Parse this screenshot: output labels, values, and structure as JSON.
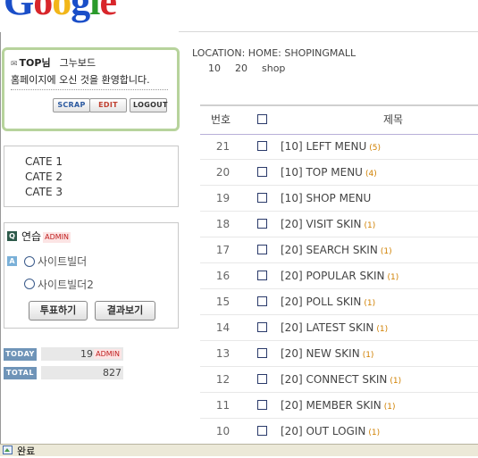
{
  "logo": {
    "text": "Google"
  },
  "login": {
    "user": "TOP님",
    "board_link": "그누보드",
    "welcome": "홈페이지에 오신 것을 환영합니다.",
    "buttons": {
      "scrap": "SCRAP",
      "edit": "EDIT",
      "logout": "LOGOUT"
    }
  },
  "categories": [
    "CATE 1",
    "CATE 2",
    "CATE 3"
  ],
  "poll": {
    "q_icon": "Q",
    "a_icon": "A",
    "title": "연습",
    "admin_badge": "ADMIN",
    "options": [
      "사이트빌더",
      "사이트빌더2"
    ],
    "vote_button": "투표하기",
    "result_button": "결과보기"
  },
  "counter": {
    "today_label": "TODAY",
    "today_value": "19",
    "today_admin": "ADMIN",
    "total_label": "TOTAL",
    "total_value": "827"
  },
  "location": {
    "text": "LOCATION: HOME: SHOPINGMALL",
    "links": [
      "10",
      "20",
      "shop"
    ]
  },
  "table": {
    "col_num": "번호",
    "col_title": "제목",
    "rows": [
      {
        "num": "21",
        "title": "[10] LEFT MENU",
        "comments": "(5)"
      },
      {
        "num": "20",
        "title": "[10] TOP MENU",
        "comments": "(4)"
      },
      {
        "num": "19",
        "title": "[10] SHOP MENU",
        "comments": ""
      },
      {
        "num": "18",
        "title": "[20] VISIT SKIN",
        "comments": "(1)"
      },
      {
        "num": "17",
        "title": "[20] SEARCH SKIN",
        "comments": "(1)"
      },
      {
        "num": "16",
        "title": "[20] POPULAR SKIN",
        "comments": "(1)"
      },
      {
        "num": "15",
        "title": "[20] POLL SKIN",
        "comments": "(1)"
      },
      {
        "num": "14",
        "title": "[20] LATEST SKIN",
        "comments": "(1)"
      },
      {
        "num": "13",
        "title": "[20] NEW SKIN",
        "comments": "(1)"
      },
      {
        "num": "12",
        "title": "[20] CONNECT SKIN",
        "comments": "(1)"
      },
      {
        "num": "11",
        "title": "[20] MEMBER SKIN",
        "comments": "(1)"
      },
      {
        "num": "10",
        "title": "[20] OUT LOGIN",
        "comments": "(1)"
      }
    ]
  },
  "statusbar": {
    "text": "완료",
    "icon": "ie-page-icon"
  }
}
